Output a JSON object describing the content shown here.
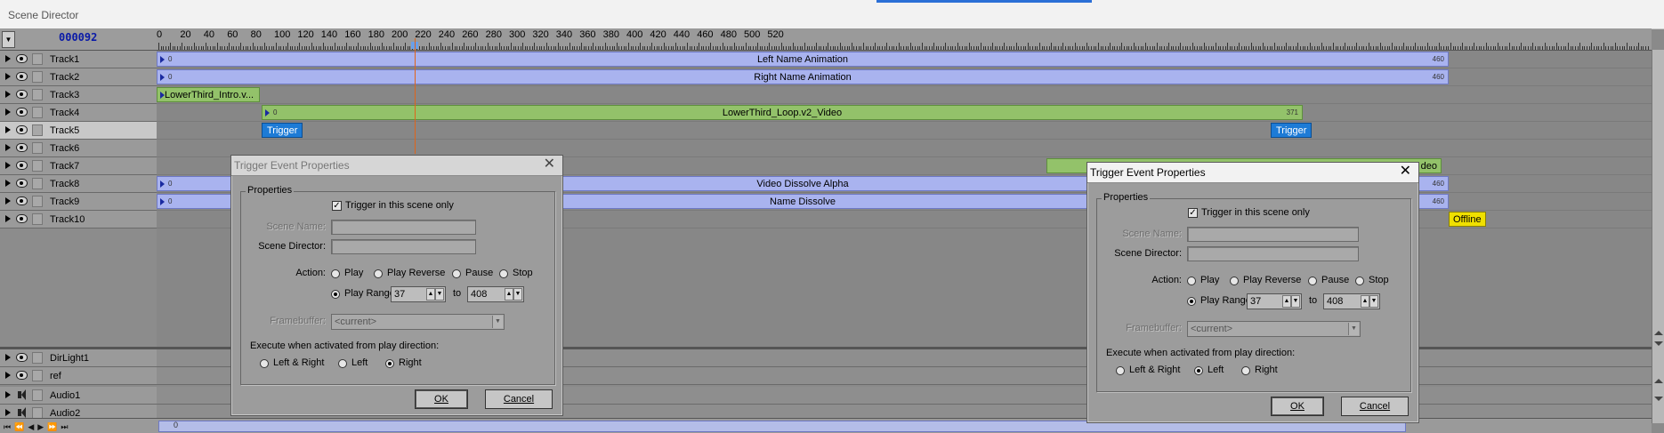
{
  "window": {
    "title": "Scene Director"
  },
  "header": {
    "frame_counter": "000092",
    "dropdown_glyph": "▼"
  },
  "ruler": {
    "labels": [
      "0",
      "20",
      "40",
      "60",
      "80",
      "100",
      "120",
      "140",
      "160",
      "180",
      "200",
      "220",
      "240",
      "260",
      "280",
      "300",
      "320",
      "340",
      "360",
      "380",
      "400",
      "420",
      "440",
      "460",
      "480",
      "500",
      "520"
    ]
  },
  "tracks": [
    {
      "name": "Track1"
    },
    {
      "name": "Track2"
    },
    {
      "name": "Track3"
    },
    {
      "name": "Track4"
    },
    {
      "name": "Track5"
    },
    {
      "name": "Track6"
    },
    {
      "name": "Track7"
    },
    {
      "name": "Track8"
    },
    {
      "name": "Track9"
    },
    {
      "name": "Track10"
    }
  ],
  "lower_tracks": [
    {
      "name": "DirLight1"
    },
    {
      "name": "ref"
    },
    {
      "name": "Audio1"
    },
    {
      "name": "Audio2"
    }
  ],
  "clips": {
    "track1": {
      "label": "Left Name Animation",
      "start": "0",
      "end": "460"
    },
    "track2": {
      "label": "Right Name Animation",
      "start": "0",
      "end": "460"
    },
    "track3": {
      "label": "LowerThird_Intro.v..."
    },
    "track4": {
      "label": "LowerThird_Loop.v2_Video",
      "start": "0",
      "end": "371"
    },
    "track5_trigger_a": "Trigger",
    "track5_trigger_b": "Trigger",
    "track7": {
      "label": "deo"
    },
    "track8": {
      "label": "Video Dissolve Alpha",
      "start": "0",
      "end": "460"
    },
    "track9": {
      "label": "Name Dissolve",
      "start": "0",
      "end": "460"
    },
    "track10_offline": "Offline"
  },
  "transport": {
    "buttons": [
      "⏮",
      "⏪",
      "◀",
      "▶",
      "⏩",
      "⏭"
    ]
  },
  "hscroll": {
    "start": "0"
  },
  "dialog_left": {
    "title": "Trigger Event Properties",
    "group_title": "Properties",
    "trigger_only_label": "Trigger in this scene only",
    "scene_name_label": "Scene Name:",
    "scene_director_label": "Scene Director:",
    "action_label": "Action:",
    "actions": [
      "Play",
      "Play Reverse",
      "Pause",
      "Stop"
    ],
    "play_range_label": "Play Range:",
    "range_from": "37",
    "range_to_label": "to",
    "range_to": "408",
    "framebuffer_label": "Framebuffer:",
    "framebuffer_value": "<current>",
    "execute_label": "Execute when activated from play direction:",
    "directions": [
      "Left & Right",
      "Left",
      "Right"
    ],
    "selected_direction": "Right",
    "ok_label": "OK",
    "cancel_label": "Cancel"
  },
  "dialog_right": {
    "title": "Trigger Event Properties",
    "group_title": "Properties",
    "trigger_only_label": "Trigger in this scene only",
    "scene_name_label": "Scene Name:",
    "scene_director_label": "Scene Director:",
    "action_label": "Action:",
    "actions": [
      "Play",
      "Play Reverse",
      "Pause",
      "Stop"
    ],
    "play_range_label": "Play Range:",
    "range_from": "37",
    "range_to_label": "to",
    "range_to": "408",
    "framebuffer_label": "Framebuffer:",
    "framebuffer_value": "<current>",
    "execute_label": "Execute when activated from play direction:",
    "directions": [
      "Left & Right",
      "Left",
      "Right"
    ],
    "selected_direction": "Left",
    "ok_label": "OK",
    "cancel_label": "Cancel"
  },
  "colors": {
    "clip_blue": "#a9b3ef",
    "clip_green": "#93c26a",
    "trigger": "#1d7bd6",
    "offline": "#f0e000",
    "playhead": "#e0641a"
  }
}
